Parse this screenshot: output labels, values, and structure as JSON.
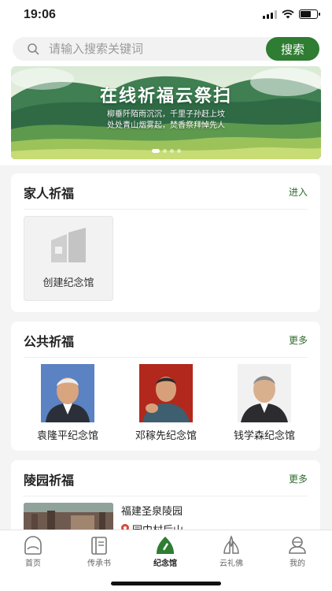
{
  "status_bar": {
    "time": "19:06"
  },
  "search": {
    "placeholder": "请输入搜索关键词",
    "button_label": "搜索"
  },
  "banner": {
    "title": "在线祈福云祭扫",
    "line1": "柳垂阡陌雨沉沉，千里子孙赶上坟",
    "line2": "处处青山烟雾起，焚香祭拜悼先人"
  },
  "family_blessing": {
    "title": "家人祈福",
    "more_label": "进入",
    "create_label": "创建纪念馆"
  },
  "public_blessing": {
    "title": "公共祈福",
    "more_label": "更多",
    "memorials": [
      {
        "name": "袁隆平纪念馆"
      },
      {
        "name": "邓稼先纪念馆"
      },
      {
        "name": "钱学森纪念馆"
      }
    ]
  },
  "cemetery_blessing": {
    "title": "陵园祈福",
    "more_label": "更多",
    "item": {
      "name": "福建圣泉陵园",
      "location": "园中村后山"
    }
  },
  "tabs": [
    {
      "label": "首页",
      "icon": "home-icon",
      "active": false
    },
    {
      "label": "传承书",
      "icon": "book-icon",
      "active": false
    },
    {
      "label": "纪念馆",
      "icon": "memorial-hall-icon",
      "active": true
    },
    {
      "label": "云礼佛",
      "icon": "buddha-icon",
      "active": false
    },
    {
      "label": "我的",
      "icon": "profile-icon",
      "active": false
    }
  ],
  "colors": {
    "accent": "#2e7d32",
    "more_link": "#2e6b2e",
    "background": "#f4f4f4"
  }
}
